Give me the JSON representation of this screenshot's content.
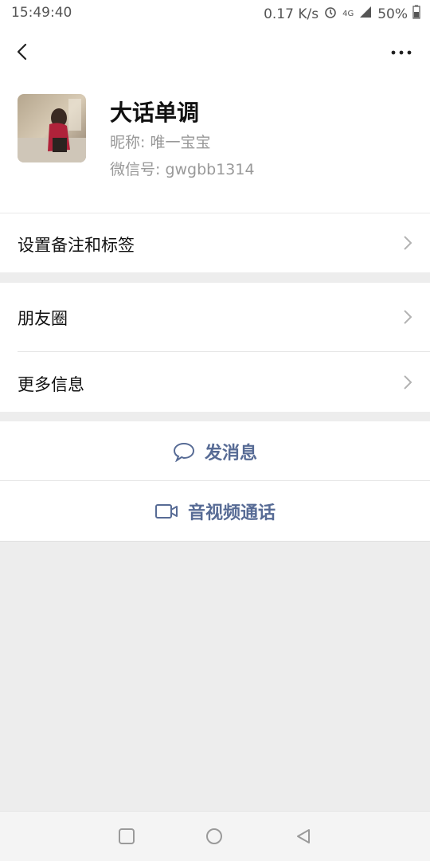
{
  "status_bar": {
    "time": "15:49:40",
    "net_speed": "0.17 K/s",
    "network": "4G",
    "battery": "50%"
  },
  "nav": {
    "back_icon": "chevron-left-icon",
    "more_icon": "more-icon"
  },
  "profile": {
    "name": "大话单调",
    "nickname": "昵称: 唯一宝宝",
    "wechat_id": "微信号: gwgbb1314"
  },
  "menu": {
    "remark_label": "设置备注和标签",
    "moments_label": "朋友圈",
    "more_info_label": "更多信息"
  },
  "actions": {
    "message_label": "发消息",
    "call_label": "音视频通话"
  },
  "colors": {
    "accent": "#576b95",
    "background": "#ededed"
  }
}
